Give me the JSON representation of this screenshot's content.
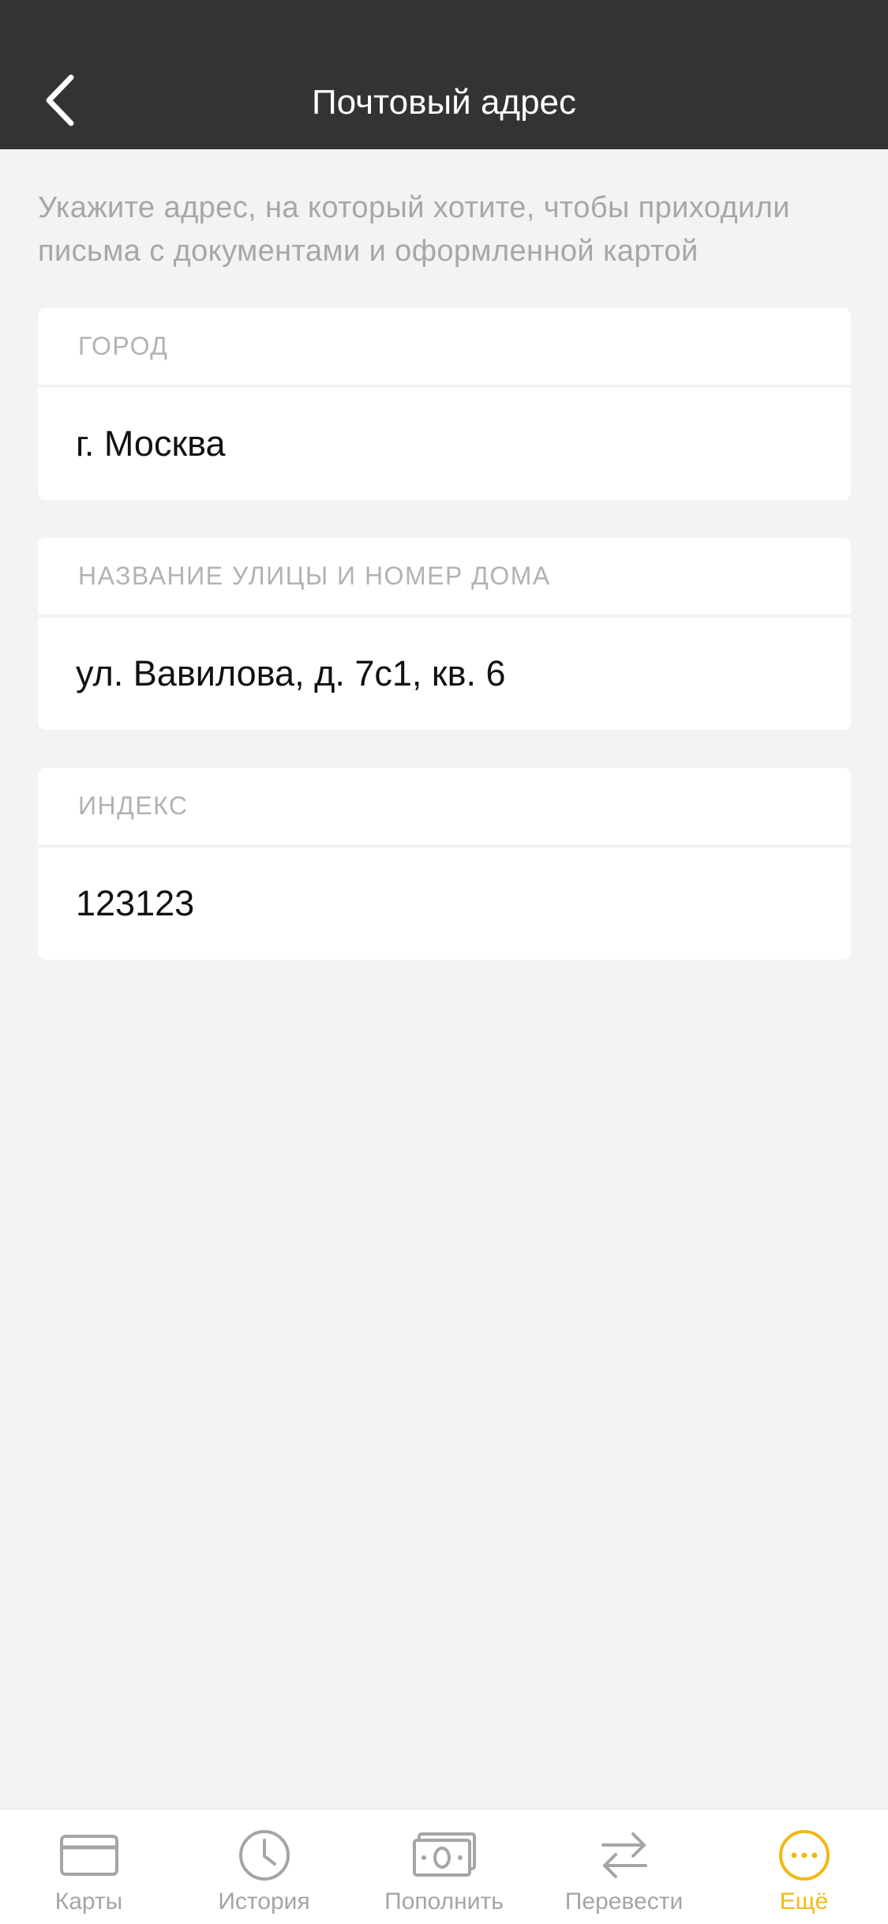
{
  "header": {
    "title": "Почтовый адрес",
    "back_icon": "chevron-left-icon"
  },
  "description": "Укажите адрес, на который хотите, чтобы приходили письма с документами и оформленной картой",
  "fields": [
    {
      "label": "ГОРОД",
      "value": "г. Москва"
    },
    {
      "label": "НАЗВАНИЕ УЛИЦЫ И НОМЕР ДОМА",
      "value": "ул. Вавилова, д. 7с1, кв. 6"
    },
    {
      "label": "ИНДЕКС",
      "value": "123123"
    }
  ],
  "tabbar": {
    "items": [
      {
        "label": "Карты",
        "icon": "card-icon",
        "active": false
      },
      {
        "label": "История",
        "icon": "clock-icon",
        "active": false
      },
      {
        "label": "Пополнить",
        "icon": "cash-icon",
        "active": false
      },
      {
        "label": "Перевести",
        "icon": "transfer-arrows-icon",
        "active": false
      },
      {
        "label": "Ещё",
        "icon": "more-dots-icon",
        "active": true
      }
    ]
  },
  "colors": {
    "header_bg": "#333333",
    "page_bg": "#f3f3f3",
    "accent": "#f3b814",
    "inactive_icon": "#a5a5a5"
  }
}
